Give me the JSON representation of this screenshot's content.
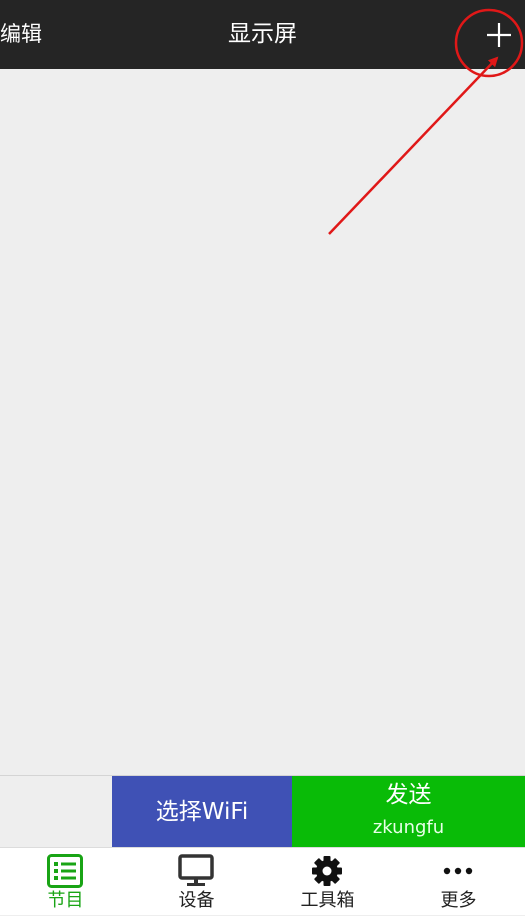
{
  "header": {
    "edit_label": "编辑",
    "title": "显示屏",
    "add_icon": "plus-icon"
  },
  "annotation": {
    "color": "#e01818",
    "shapes": [
      "circle-around-add-button",
      "arrow-pointing-to-add-button"
    ]
  },
  "action_bar": {
    "wifi_label": "选择WiFi",
    "send_label": "发送",
    "send_device": "zkungfu"
  },
  "bottom_nav": {
    "items": [
      {
        "label": "节目",
        "icon": "program-list-icon",
        "active": true
      },
      {
        "label": "设备",
        "icon": "monitor-icon",
        "active": false
      },
      {
        "label": "工具箱",
        "icon": "gear-icon",
        "active": false
      },
      {
        "label": "更多",
        "icon": "more-dots-icon",
        "active": false
      }
    ]
  },
  "colors": {
    "header_bg": "#252525",
    "content_bg": "#eeeeee",
    "wifi_button": "#3f51b5",
    "send_button": "#09bb07",
    "nav_active": "#19a415",
    "nav_inactive": "#222222"
  }
}
